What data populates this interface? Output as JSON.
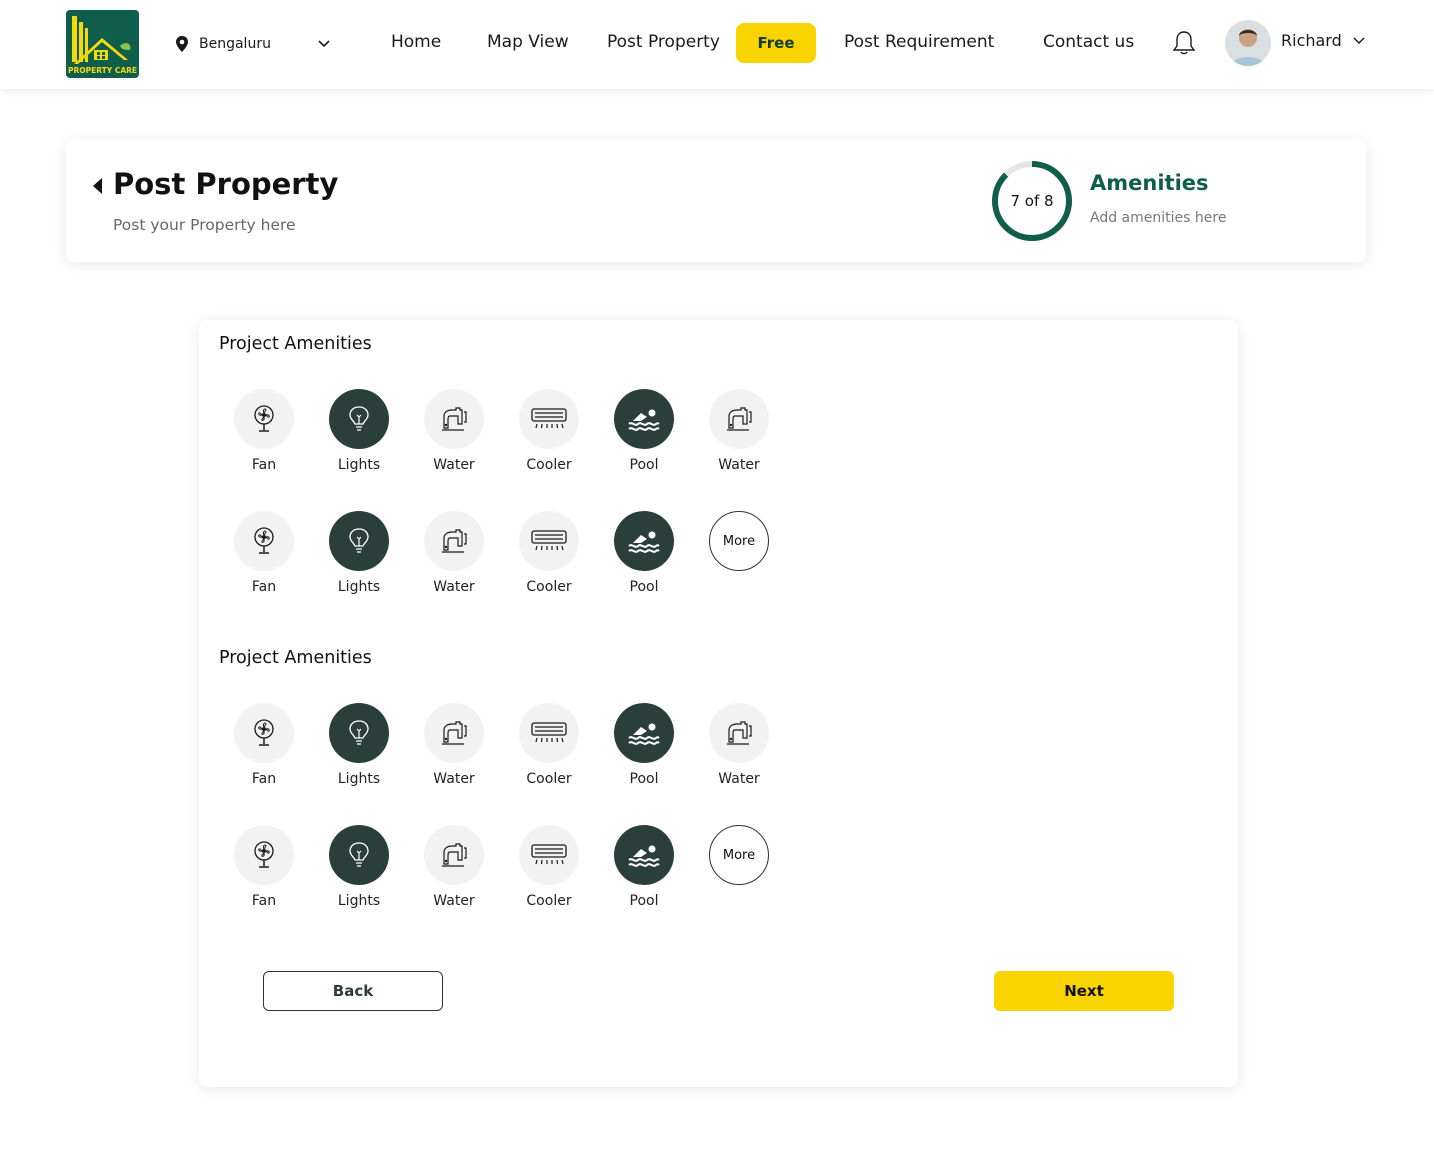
{
  "header": {
    "logo_text": "PROPERTY CARE",
    "location": "Bengaluru",
    "nav": [
      "Home",
      "Map View",
      "Post Property",
      "Post Requirement",
      "Contact us"
    ],
    "free_badge": "Free",
    "user_name": "Richard"
  },
  "step_card": {
    "title": "Post Property",
    "subtitle": "Post your Property here",
    "progress_text": "7 of 8",
    "progress": {
      "current": 7,
      "total": 8
    },
    "step_title": "Amenities",
    "step_subtitle": "Add amenities here"
  },
  "sections": [
    {
      "title": "Project Amenities",
      "rows": [
        [
          {
            "label": "Fan",
            "icon": "fan-icon",
            "active": false
          },
          {
            "label": "Lights",
            "icon": "bulb-icon",
            "active": true
          },
          {
            "label": "Water",
            "icon": "tap-icon",
            "active": false
          },
          {
            "label": "Cooler",
            "icon": "ac-icon",
            "active": false
          },
          {
            "label": "Pool",
            "icon": "swim-icon",
            "active": true
          },
          {
            "label": "Water",
            "icon": "tap-icon",
            "active": false
          }
        ],
        [
          {
            "label": "Fan",
            "icon": "fan-icon",
            "active": false
          },
          {
            "label": "Lights",
            "icon": "bulb-icon",
            "active": true
          },
          {
            "label": "Water",
            "icon": "tap-icon",
            "active": false
          },
          {
            "label": "Cooler",
            "icon": "ac-icon",
            "active": false
          },
          {
            "label": "Pool",
            "icon": "swim-icon",
            "active": true
          }
        ]
      ],
      "more_label": "More"
    },
    {
      "title": "Project Amenities",
      "rows": [
        [
          {
            "label": "Fan",
            "icon": "fan-icon",
            "active": false
          },
          {
            "label": "Lights",
            "icon": "bulb-icon",
            "active": true
          },
          {
            "label": "Water",
            "icon": "tap-icon",
            "active": false
          },
          {
            "label": "Cooler",
            "icon": "ac-icon",
            "active": false
          },
          {
            "label": "Pool",
            "icon": "swim-icon",
            "active": true
          },
          {
            "label": "Water",
            "icon": "tap-icon",
            "active": false
          }
        ],
        [
          {
            "label": "Fan",
            "icon": "fan-icon",
            "active": false
          },
          {
            "label": "Lights",
            "icon": "bulb-icon",
            "active": true
          },
          {
            "label": "Water",
            "icon": "tap-icon",
            "active": false
          },
          {
            "label": "Cooler",
            "icon": "ac-icon",
            "active": false
          },
          {
            "label": "Pool",
            "icon": "swim-icon",
            "active": true
          }
        ]
      ],
      "more_label": "More"
    }
  ],
  "buttons": {
    "back": "Back",
    "next": "Next"
  },
  "colors": {
    "brand_green": "#0f5e4c",
    "accent_yellow": "#fad400",
    "active_icon_bg": "#2b3f3a"
  }
}
